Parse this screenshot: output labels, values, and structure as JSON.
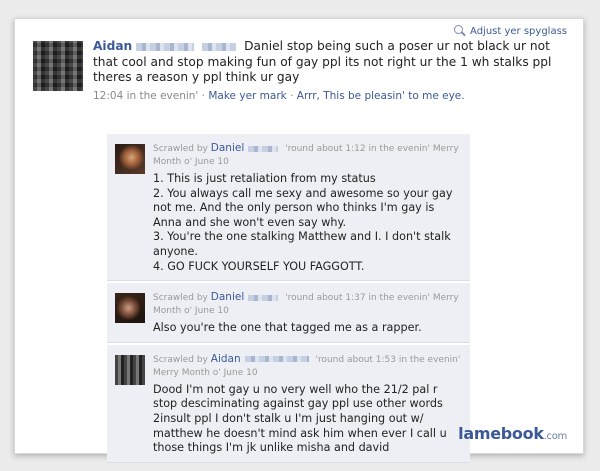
{
  "header": {
    "spyglass_label": "Adjust yer spyglass",
    "spyglass_icon": "magnifier-icon"
  },
  "post": {
    "author": "Aidan",
    "message": "Daniel stop being such a poser ur not black ur not that cool and stop making fun of gay ppl its not right ur the 1 wh stalks ppl theres a reason y ppl think ur gay",
    "time": "12:04 in the evenin'",
    "separator": "·",
    "make_mark": "Make yer mark",
    "like_text": "Arrr, This be pleasin' to me eye."
  },
  "comments": [
    {
      "prefix": "Scrawled by",
      "author": "Daniel",
      "when": "'round about 1:12 in the evenin' Merry Month o' June 10",
      "lines": [
        "1. This is just retaliation from my status",
        "2. You always call me sexy and awesome so your gay not me. And the only person who thinks I'm gay is Anna and she won't even say why.",
        "3. You're the one stalking Matthew and I. I don't stalk anyone.",
        "4. GO FUCK YOURSELF YOU FAGGOTT."
      ]
    },
    {
      "prefix": "Scrawled by",
      "author": "Daniel",
      "when": "'round about 1:37 in the evenin' Merry Month o' June 10",
      "lines": [
        "Also you're the one that tagged me as a rapper."
      ]
    },
    {
      "prefix": "Scrawled by",
      "author": "Aidan",
      "when": "'round about 1:53 in the evenin' Merry Month o' June 10",
      "lines": [
        "Dood I'm not gay u no very well who the 21/2 pal r stop desciminating against gay ppl use other words 2insult ppl I don't stalk u I'm just hanging out w/ matthew he doesn't mind ask him when ever I call u those things I'm jk unlike misha and david"
      ]
    }
  ],
  "brand": {
    "name": "lamebook",
    "suffix": ".com"
  }
}
